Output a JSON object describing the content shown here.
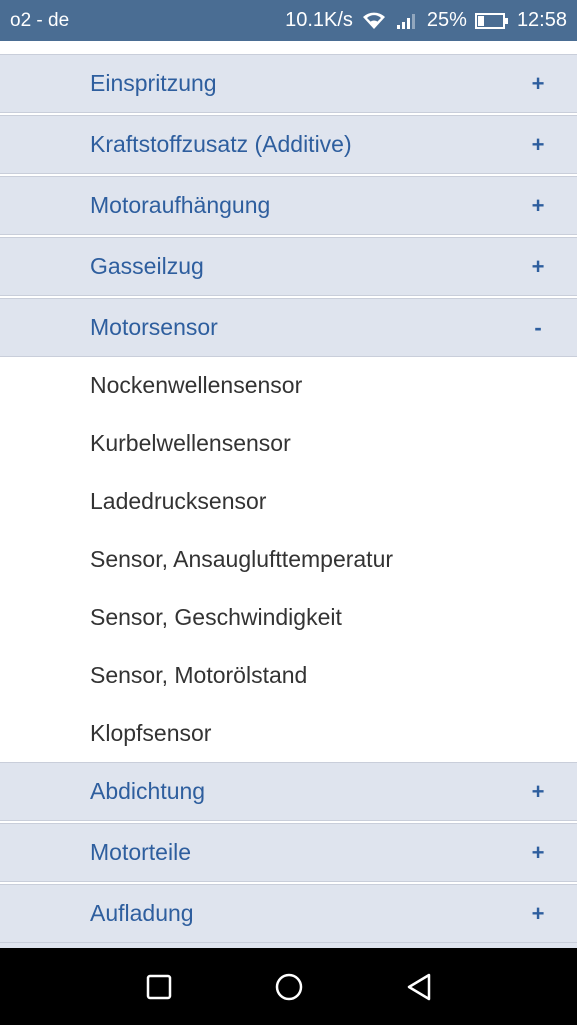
{
  "status_bar": {
    "carrier": "o2 - de",
    "net_speed": "10.1K/s",
    "battery_percent": "25%",
    "battery_level": 0.25,
    "time": "12:58"
  },
  "categories_before": [
    {
      "label": "Einspritzung",
      "toggle": "+"
    },
    {
      "label": "Kraftstoffzusatz (Additive)",
      "toggle": "+"
    },
    {
      "label": "Motoraufhängung",
      "toggle": "+"
    },
    {
      "label": "Gasseilzug",
      "toggle": "+"
    }
  ],
  "expanded_category": {
    "label": "Motorsensor",
    "toggle": "-",
    "items": [
      "Nockenwellensensor",
      "Kurbelwellensensor",
      "Ladedrucksensor",
      "Sensor, Ansauglufttemperatur",
      "Sensor, Geschwindigkeit",
      "Sensor, Motorölstand",
      "Klopfsensor"
    ]
  },
  "categories_after": [
    {
      "label": "Abdichtung",
      "toggle": "+"
    },
    {
      "label": "Motorteile",
      "toggle": "+"
    },
    {
      "label": "Aufladung",
      "toggle": "+"
    }
  ],
  "colors": {
    "status_bar": "#4a6d93",
    "category_bg": "#dfe4ee",
    "category_text": "#2e5e9e",
    "item_text": "#333333",
    "nav_bar": "#000000"
  },
  "nav": {
    "icons": [
      "recent-apps-icon",
      "home-icon",
      "back-icon"
    ]
  }
}
